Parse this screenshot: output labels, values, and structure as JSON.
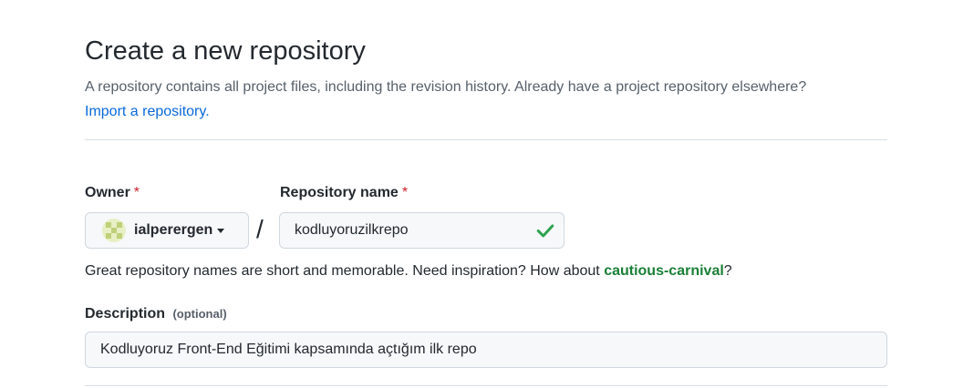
{
  "header": {
    "title": "Create a new repository",
    "subtitle": "A repository contains all project files, including the revision history. Already have a project repository elsewhere?",
    "import_link": "Import a repository."
  },
  "form": {
    "owner": {
      "label": "Owner",
      "required_mark": "*",
      "value": "ialperergen",
      "avatar_icon": "identicon-avatar"
    },
    "separator": "/",
    "repo_name": {
      "label": "Repository name",
      "required_mark": "*",
      "value": "kodluyoruzilkrepo",
      "status_icon": "check-icon",
      "status_color": "#2da44e"
    },
    "hint": {
      "prefix": "Great repository names are short and memorable. Need inspiration? How about",
      "suggestion": "cautious-carnival",
      "suffix": "?"
    },
    "description": {
      "label": "Description",
      "optional": "(optional)",
      "value": "Kodluyoruz Front-End Eğitimi kapsamında açtığım ilk repo"
    }
  },
  "colors": {
    "link": "#0969da",
    "suggestion": "#1a7f37",
    "required": "#cf222e"
  }
}
